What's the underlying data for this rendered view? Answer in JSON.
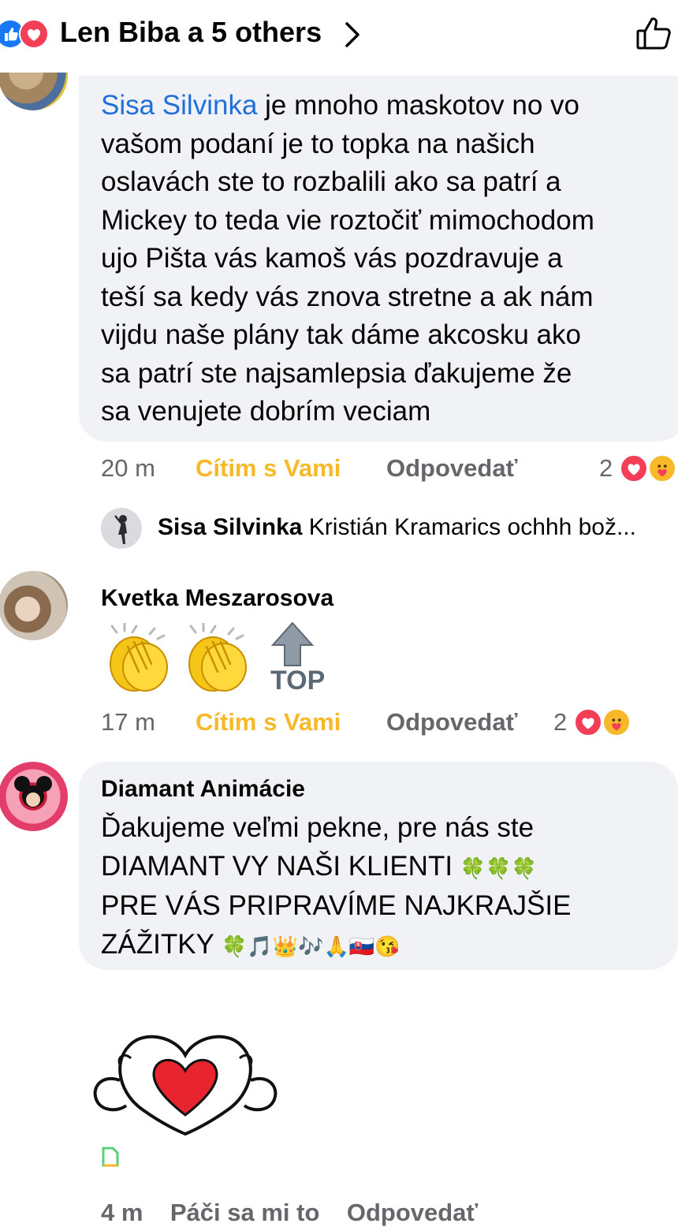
{
  "header": {
    "reactions_summary": "Len Biba a 5 others",
    "icons": [
      "like-reaction-icon",
      "love-reaction-icon",
      "chevron-right-icon",
      "like-outline-icon"
    ]
  },
  "comments": [
    {
      "author": "Kristián Kramarics",
      "mention": "Sisa Silvinka",
      "text_lines": [
        " je mnoho maskotov no vo",
        "vašom podaní je to topka na našich",
        "oslavách ste to rozbalili ako sa patrí a",
        "Mickey to teda vie roztočiť mimochodom",
        "ujo Pišta vás kamoš vás pozdravuje a",
        "teší sa kedy vás znova stretne a ak nám",
        "vijdu naše plány tak dáme akcosku ako",
        "sa patrí ste najsamlepsia ďakujeme že",
        "sa venujete dobrím veciam"
      ],
      "time": "20 m",
      "care_label": "Cítim s Vami",
      "reply_label": "Odpovedať",
      "reaction_count": "2",
      "reply_preview": {
        "author": "Sisa Silvinka",
        "text": "Kristián Kramarics ochhh bož..."
      }
    },
    {
      "author": "Kvetka Meszarosova",
      "emoji_content": [
        "clapping-hands-icon",
        "clapping-hands-icon",
        "top-arrow-icon"
      ],
      "top_label": "TOP",
      "time": "17 m",
      "care_label": "Cítim s Vami",
      "reply_label": "Odpovedať",
      "reaction_count": "2"
    },
    {
      "author": "Diamant Animácie",
      "line1": "Ďakujeme veľmi pekne, pre nás ste",
      "line2": "DIAMANT VY NAŠI KLIENTI",
      "line3": "PRE VÁS PRIPRAVÍME NAJKRAJŠIE",
      "line4": "ZÁŽITKY",
      "emojis_line2": "🍀🍀🍀",
      "emojis_line4": "🍀🎵👑🎶🙏🇸🇰😘",
      "sticker": "heart-hands-sticker-icon",
      "partial_meta": "4 m    Páči sa mi to    Odpovedať"
    }
  ],
  "colors": {
    "link_blue": "#216fdb",
    "care_yellow": "#f7b928",
    "meta_gray": "#65676b",
    "bubble_gray": "#f0f2f5",
    "like_blue": "#1877f2",
    "love_red": "#f33e58"
  }
}
